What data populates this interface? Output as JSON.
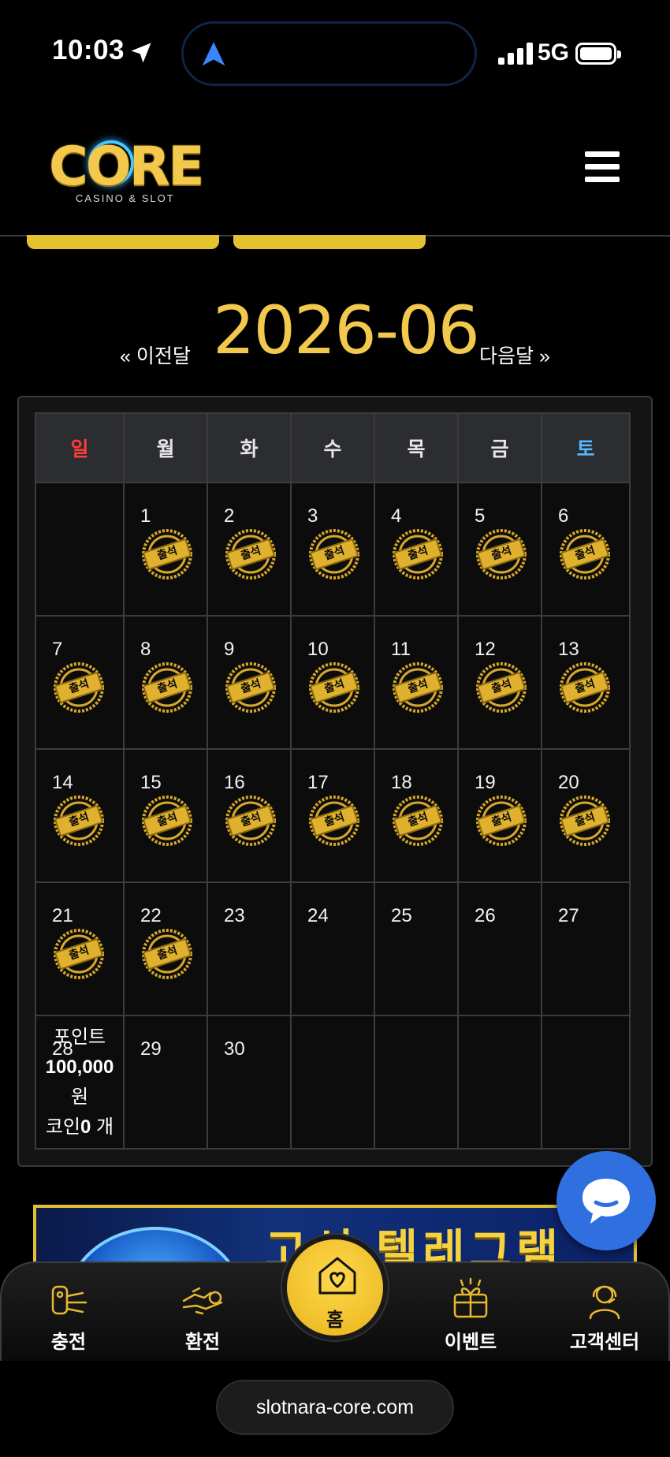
{
  "status_bar": {
    "time": "10:03",
    "network": "5G",
    "icons": [
      "location-arrow-icon",
      "navigation-icon",
      "signal-icon",
      "battery-icon"
    ]
  },
  "header": {
    "logo_text": "CORE",
    "logo_tagline": "CASINO & SLOT",
    "menu_icon": "hamburger-menu-icon"
  },
  "calendar": {
    "prev_label": "« 이전달",
    "month": "2026-06",
    "next_label": "다음달 »",
    "weekdays": [
      "일",
      "월",
      "화",
      "수",
      "목",
      "금",
      "토"
    ],
    "stamp_label": "출석",
    "attended_through": 22,
    "weeks": [
      [
        "",
        "1",
        "2",
        "3",
        "4",
        "5",
        "6"
      ],
      [
        "7",
        "8",
        "9",
        "10",
        "11",
        "12",
        "13"
      ],
      [
        "14",
        "15",
        "16",
        "17",
        "18",
        "19",
        "20"
      ],
      [
        "21",
        "22",
        "23",
        "24",
        "25",
        "26",
        "27"
      ],
      [
        "28",
        "29",
        "30",
        "",
        "",
        "",
        ""
      ]
    ],
    "points_box": {
      "label": "포인트",
      "amount": "100,000",
      "unit": "원",
      "coin_prefix": "코인",
      "coin_count": "0",
      "coin_unit": "개"
    }
  },
  "banner": {
    "text": "고신 텔레그램"
  },
  "chat_button": {
    "icon": "chat-bubble-icon"
  },
  "bottom_nav": {
    "items": [
      {
        "label": "충전",
        "icon": "deposit-icon"
      },
      {
        "label": "환전",
        "icon": "withdraw-icon"
      },
      {
        "label": "홈",
        "icon": "home-heart-icon"
      },
      {
        "label": "이벤트",
        "icon": "gift-icon"
      },
      {
        "label": "고객센터",
        "icon": "support-icon"
      }
    ]
  },
  "browser": {
    "url": "slotnara-core.com"
  },
  "colors": {
    "gold": "#f2c94c",
    "sunday": "#ff3b3b",
    "saturday": "#58b7ff",
    "chat_blue": "#2f6fe0"
  }
}
